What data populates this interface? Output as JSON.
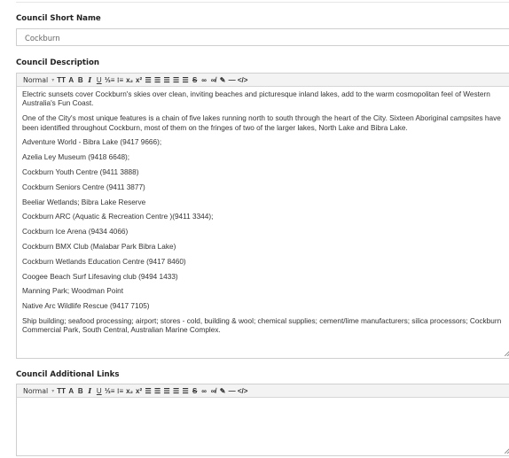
{
  "short_name": {
    "label": "Council Short Name",
    "value": "Cockburn"
  },
  "toolbar": {
    "style_select": "Normal",
    "buttons": [
      {
        "name": "font-size-icon",
        "glyph": "TT"
      },
      {
        "name": "text-color-icon",
        "glyph": "A"
      },
      {
        "name": "bold-icon",
        "glyph": "B"
      },
      {
        "name": "italic-icon",
        "glyph": "I"
      },
      {
        "name": "underline-icon",
        "glyph": "U"
      },
      {
        "name": "ordered-list-icon",
        "glyph": "⅓≡"
      },
      {
        "name": "bullet-list-icon",
        "glyph": "⁝≡"
      },
      {
        "name": "subscript-icon",
        "glyph": "x₂"
      },
      {
        "name": "superscript-icon",
        "glyph": "x²"
      },
      {
        "name": "align-justify-icon",
        "glyph": "☰"
      },
      {
        "name": "align-left-icon",
        "glyph": "☰"
      },
      {
        "name": "align-right-icon",
        "glyph": "☰"
      },
      {
        "name": "align-center-icon",
        "glyph": "☰"
      },
      {
        "name": "indent-icon",
        "glyph": "☰"
      },
      {
        "name": "strikethrough-icon",
        "glyph": "S"
      },
      {
        "name": "link-icon",
        "glyph": "∞"
      },
      {
        "name": "unlink-icon",
        "glyph": "∞̸"
      },
      {
        "name": "clear-format-icon",
        "glyph": "✎"
      },
      {
        "name": "horizontal-rule-icon",
        "glyph": "—"
      },
      {
        "name": "code-view-icon",
        "glyph": "</>"
      }
    ]
  },
  "description": {
    "label": "Council Description",
    "paragraphs": [
      "Electric sunsets cover Cockburn's skies over clean, inviting beaches and picturesque inland lakes, add to the warm cosmopolitan feel of Western Australia's Fun Coast.",
      "One of the City's most unique features is a chain of five lakes running north to south through the heart of the City. Sixteen Aboriginal campsites have been identified throughout Cockburn, most of them on the fringes of two of the larger lakes, North Lake and Bibra Lake.",
      "Adventure World - Bibra Lake (9417 9666);",
      "Azelia Ley Museum (9418 6648);",
      "Cockburn Youth Centre (9411 3888)",
      "Cockburn Seniors Centre (9411 3877)",
      "Beeliar Wetlands; Bibra Lake Reserve",
      "Cockburn ARC (Aquatic & Recreation Centre )(9411 3344);",
      "Cockburn Ice Arena (9434 4066)",
      "Cockburn BMX Club (Malabar Park Bibra Lake)",
      "Cockburn Wetlands Education Centre (9417 8460)",
      "Coogee Beach Surf Lifesaving club (9494 1433)",
      "Manning Park; Woodman Point",
      "Native Arc Wildlife Rescue (9417 7105)",
      "Ship building; seafood processing; airport; stores - cold, building & wool; chemical supplies; cement/lime manufacturers; silica processors; Cockburn Commercial Park, South Central, Australian Marine Complex."
    ]
  },
  "additional_links": {
    "label": "Council Additional Links",
    "content": ""
  }
}
